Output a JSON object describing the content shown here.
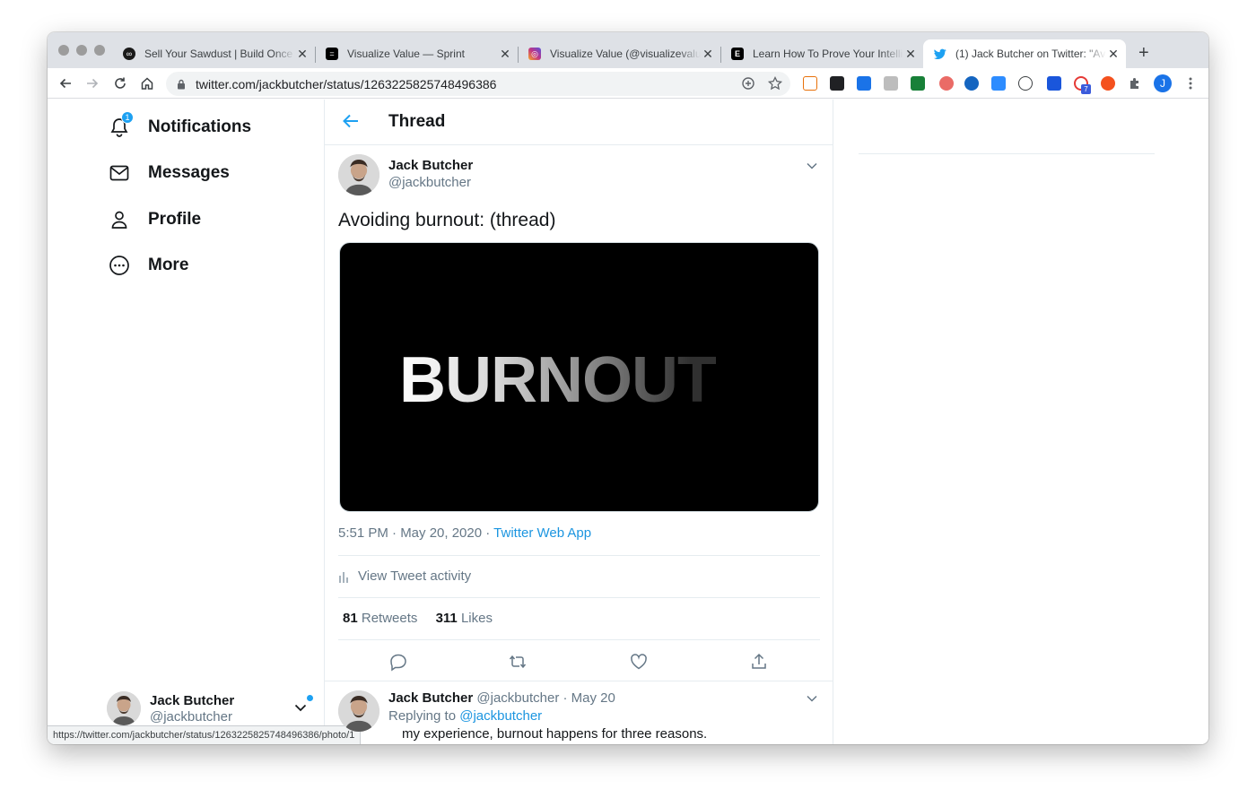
{
  "browser": {
    "tabs": [
      {
        "title": "Sell Your Sawdust | Build Once",
        "favicon": "sawdust-favicon",
        "color": "#1a1a1a"
      },
      {
        "title": "Visualize Value — Sprint",
        "favicon": "visualize-value-favicon",
        "color": "#000000"
      },
      {
        "title": "Visualize Value (@visualizevalu",
        "favicon": "instagram-favicon",
        "color": "#c13584"
      },
      {
        "title": "Learn How To Prove Your Intelli",
        "favicon": "e-favicon",
        "color": "#000000"
      },
      {
        "title": "(1) Jack Butcher on Twitter: \"Av",
        "favicon": "twitter-favicon",
        "color": "#1da1f2",
        "active": true
      }
    ],
    "close_glyph": "✕",
    "new_tab_glyph": "+",
    "url": "twitter.com/jackbutcher/status/1263225825748496386",
    "profile_initial": "J",
    "extension_badge": "7",
    "status_url": "https://twitter.com/jackbutcher/status/1263225825748496386/photo/1"
  },
  "sidebar": {
    "items": [
      {
        "label": "Notifications",
        "icon": "bell-icon",
        "badge": "1"
      },
      {
        "label": "Messages",
        "icon": "envelope-icon"
      },
      {
        "label": "Profile",
        "icon": "person-icon"
      },
      {
        "label": "More",
        "icon": "more-circle-icon"
      }
    ],
    "account": {
      "name": "Jack Butcher",
      "handle": "@jackbutcher"
    }
  },
  "main": {
    "header_title": "Thread",
    "tweet": {
      "name": "Jack Butcher",
      "handle": "@jackbutcher",
      "text": "Avoiding burnout: (thread)",
      "media_text": "BURNOUT",
      "timestamp": "5:51 PM · May 20, 2020",
      "separator": " · ",
      "source": "Twitter Web App",
      "activity_label": "View Tweet activity",
      "retweets_count": "81",
      "retweets_label": "Retweets",
      "likes_count": "311",
      "likes_label": "Likes"
    },
    "reply": {
      "name": "Jack Butcher",
      "handle": "@jackbutcher",
      "date": "· May 20",
      "replying_prefix": "Replying to",
      "replying_to": "@jackbutcher",
      "text": "my experience, burnout happens for three reasons."
    }
  },
  "colors": {
    "accent": "#1da1f2",
    "link": "#1b95e0",
    "text": "#14171a",
    "muted": "#657786"
  }
}
